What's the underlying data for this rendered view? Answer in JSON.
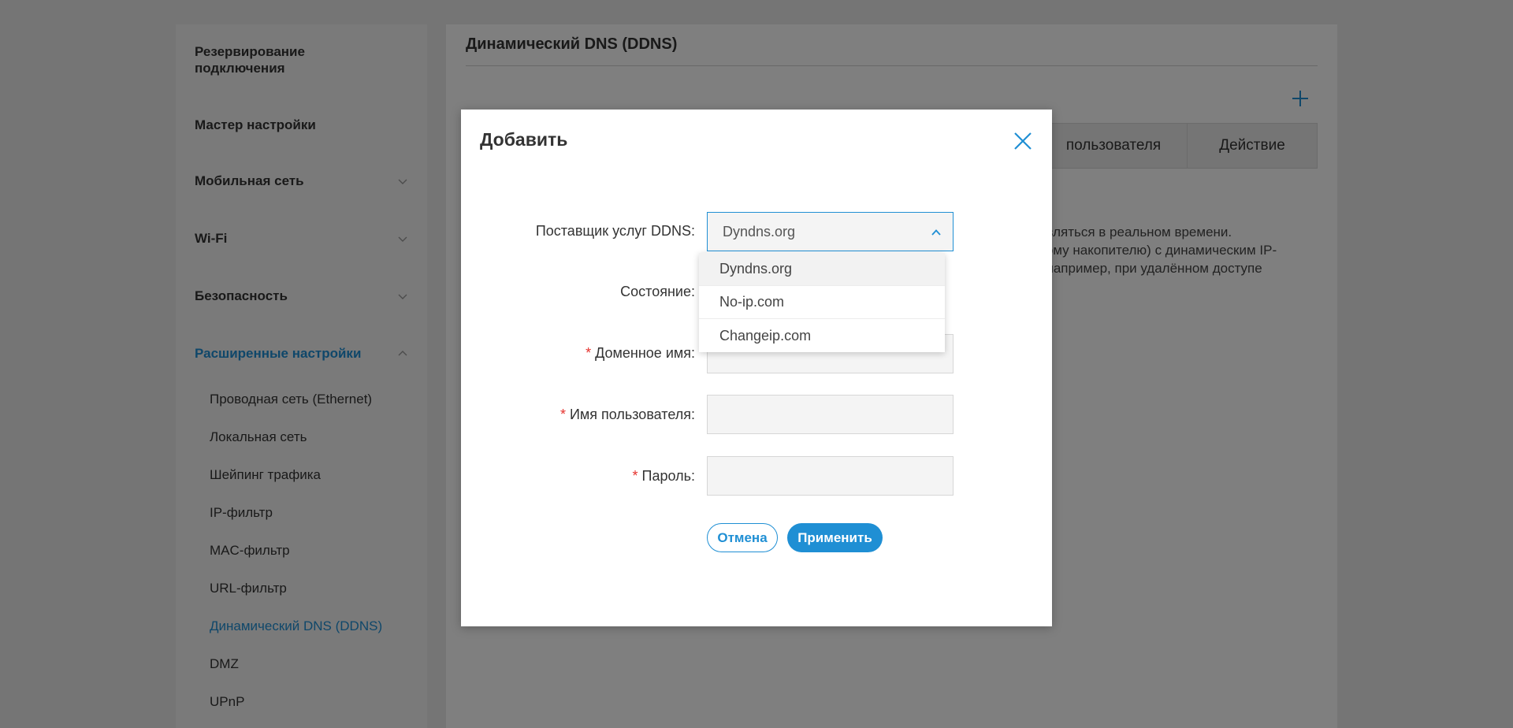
{
  "sidebar": {
    "groups": [
      {
        "label": "Резервирование подключения"
      },
      {
        "label": "Мастер настройки"
      },
      {
        "label": "Мобильная сеть"
      },
      {
        "label": "Wi-Fi"
      },
      {
        "label": "Безопасность"
      },
      {
        "label": "Расширенные настройки"
      }
    ],
    "sub_items": [
      {
        "label": "Проводная сеть (Ethernet)"
      },
      {
        "label": "Локальная сеть"
      },
      {
        "label": "Шейпинг трафика"
      },
      {
        "label": "IP-фильтр"
      },
      {
        "label": "MAC-фильтр"
      },
      {
        "label": "URL-фильтр"
      },
      {
        "label": "Динамический DNS (DDNS)"
      },
      {
        "label": "DMZ"
      },
      {
        "label": "UPnP"
      }
    ],
    "active_color": "#1f8fd4"
  },
  "main": {
    "title": "Динамический DNS (DDNS)",
    "table_headers": [
      "пользователя",
      "Действие"
    ],
    "description_lines": [
      "овляться в реальном времени.",
      "вому накопителю) с динамическим IP-",
      ", например, при удалённом доступе"
    ]
  },
  "modal": {
    "title": "Добавить",
    "fields": {
      "provider_label": "Поставщик услуг DDNS:",
      "provider_value": "Dyndns.org",
      "status_label": "Состояние:",
      "domain_label": "Доменное имя:",
      "username_label": "Имя пользователя:",
      "password_label": "Пароль:",
      "required_mark": "*"
    },
    "dropdown_options": [
      "Dyndns.org",
      "No-ip.com",
      "Changeip.com"
    ],
    "cancel_label": "Отмена",
    "apply_label": "Применить"
  },
  "colors": {
    "accent": "#1f8fd4",
    "required": "#e5322d"
  }
}
